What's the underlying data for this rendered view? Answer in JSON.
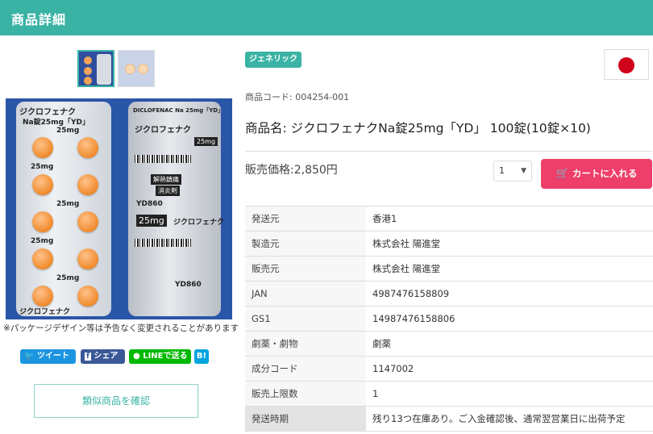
{
  "header": {
    "title": "商品詳細"
  },
  "gallery": {
    "disclaimer": "※パッケージデザイン等は予告なく変更されることがあります",
    "strip_left_text": [
      "ジクロフェナク",
      "Na錠25mg「YD」",
      "25mg",
      "25mg",
      "25mg",
      "25mg",
      "25mg",
      "ジクロフェナク"
    ],
    "strip_right_text": [
      "DICLOFENAC Na 25mg「YD」",
      "ジクロフェナク",
      "25mg",
      "解熱鎮痛",
      "消炎剤",
      "YD860",
      "25mg",
      "ジクロフェナク",
      "YD860"
    ]
  },
  "share": {
    "twitter": "ツイート",
    "facebook": "シェア",
    "line": "LINEで送る",
    "hatena": "B!"
  },
  "similar_button": "類似商品を確認",
  "product": {
    "badge": "ジェネリック",
    "code_label": "商品コード: ",
    "code_value": "004254-001",
    "title_label": "商品名: ",
    "title_value": "ジクロフェナクNa錠25mg「YD」 100錠(10錠×10)",
    "price_label": "販売価格:",
    "price_value": "2,850円",
    "quantity": "1",
    "cart_button": "カートに入れる"
  },
  "specs": [
    {
      "key": "発送元",
      "value": "香港1"
    },
    {
      "key": "製造元",
      "value": "株式会社 陽進堂"
    },
    {
      "key": "販売元",
      "value": "株式会社 陽進堂"
    },
    {
      "key": "JAN",
      "value": "4987476158809"
    },
    {
      "key": "GS1",
      "value": "14987476158806"
    },
    {
      "key": "劇薬・劇物",
      "value": "劇薬"
    },
    {
      "key": "成分コード",
      "value": "1147002"
    },
    {
      "key": "販売上限数",
      "value": "1"
    },
    {
      "key": "発送時期",
      "value": "残り13つ在庫あり。ご入金確認後、通常翌営業日に出荷予定"
    }
  ],
  "colors": {
    "header": "#3ab3a5",
    "cart": "#ee3f6a",
    "flag_red": "#d0021b"
  },
  "icons": {
    "cart": "cart-icon",
    "flag": "japan-flag-icon"
  }
}
